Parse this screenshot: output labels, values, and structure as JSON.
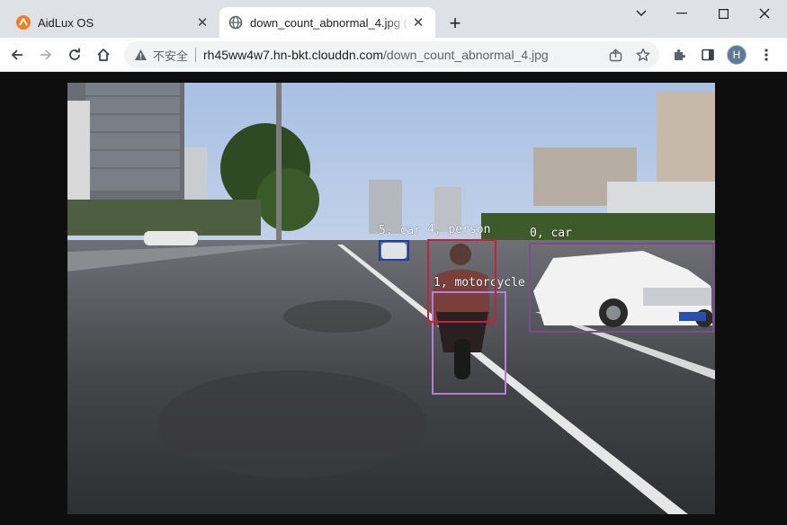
{
  "browser": {
    "tabs": [
      {
        "title": "AidLux OS",
        "icon": "aidlux-logo-icon",
        "active": false
      },
      {
        "title": "down_count_abnormal_4.jpg (",
        "icon": "globe-icon",
        "active": true
      }
    ],
    "new_tab_label": "+",
    "omnibox": {
      "security_label": "不安全",
      "url_host": "rh45ww4w7.hn-bkt.clouddn.com",
      "url_path": "/down_count_abnormal_4.jpg"
    },
    "profile_initial": "H"
  },
  "detections": [
    {
      "label": "0, car",
      "color": "#7a4d8c"
    },
    {
      "label": "1, motorcycle",
      "color": "#b57fd6"
    },
    {
      "label": "4, person",
      "color": "#c2233b"
    },
    {
      "label": "5, car",
      "color": "#1f3ea8"
    }
  ],
  "colors": {
    "tab_strip": "#dee1e6",
    "toolbar": "#ffffff",
    "page_background": "#0e0e0e",
    "aidlux_orange": "#f47c20"
  }
}
